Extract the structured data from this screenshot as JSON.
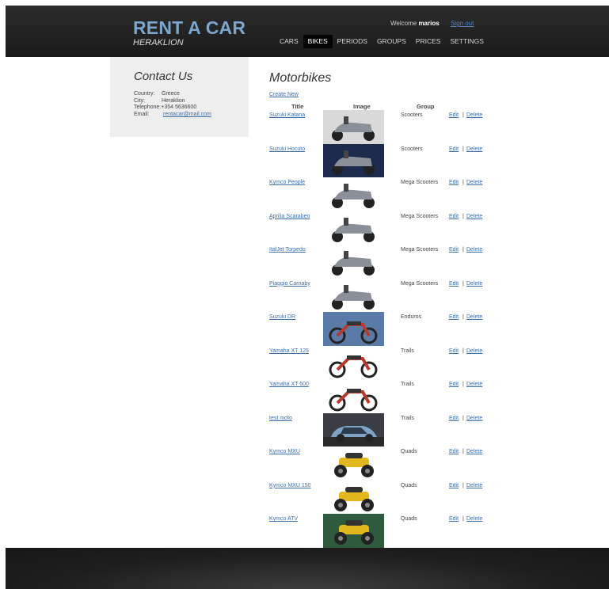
{
  "header": {
    "brand_title": "RENT A CAR",
    "brand_subtitle": "HERAKLION",
    "welcome_prefix": "Welcome",
    "username": "marios",
    "signout": "Sign out",
    "nav": [
      {
        "label": "CARS",
        "active": false
      },
      {
        "label": "BIKES",
        "active": true
      },
      {
        "label": "PERIODS",
        "active": false
      },
      {
        "label": "GROUPS",
        "active": false
      },
      {
        "label": "PRICES",
        "active": false
      },
      {
        "label": "SETTINGS",
        "active": false
      }
    ]
  },
  "sidebar": {
    "title": "Contact Us",
    "country_label": "Country:",
    "country": "Greece",
    "city_label": "City:",
    "city": "Heraklion",
    "telephone_label": "Telephone:",
    "telephone": "+354 5636600",
    "email_label": "Email:",
    "email": "rentacar@mail.com"
  },
  "main": {
    "title": "Motorbikes",
    "create_new": "Create New",
    "columns": {
      "title": "Title",
      "image": "Image",
      "group": "Group"
    },
    "edit_label": "Edit",
    "delete_label": "Delete",
    "separator": "|",
    "rows": [
      {
        "title": "Suzuki Katana",
        "group": "Scooters",
        "image_icon": "scooter-photo",
        "bg": "#d9d9d9"
      },
      {
        "title": "Suzuki Hocuto",
        "group": "Scooters",
        "image_icon": "scooter-photo",
        "bg": "#1c2a4e"
      },
      {
        "title": "Kymco People",
        "group": "Mega Scooters",
        "image_icon": "scooter-photo",
        "bg": "#ffffff"
      },
      {
        "title": "Aprilia Scarabeo",
        "group": "Mega Scooters",
        "image_icon": "scooter-photo",
        "bg": "#ffffff"
      },
      {
        "title": "ItalJet Torpedo",
        "group": "Mega Scooters",
        "image_icon": "scooter-photo",
        "bg": "#ffffff"
      },
      {
        "title": "Piaggio Carnaby",
        "group": "Mega Scooters",
        "image_icon": "scooter-photo",
        "bg": "#ffffff"
      },
      {
        "title": "Suzuki DR",
        "group": "Enduros",
        "image_icon": "motorcycle-photo",
        "bg": "#5a7aa8"
      },
      {
        "title": "Yamaha XT 125",
        "group": "Trails",
        "image_icon": "motorcycle-photo",
        "bg": "#ffffff"
      },
      {
        "title": "Yamaha XT 600",
        "group": "Trails",
        "image_icon": "motorcycle-photo",
        "bg": "#ffffff"
      },
      {
        "title": "test moto",
        "group": "Trails",
        "image_icon": "car-photo",
        "bg": "#3a3d44"
      },
      {
        "title": "Kymco MXU",
        "group": "Quads",
        "image_icon": "quad-photo",
        "bg": "#ffffff"
      },
      {
        "title": "Kymco MXU 150",
        "group": "Quads",
        "image_icon": "quad-photo",
        "bg": "#ffffff"
      },
      {
        "title": "Kymco ATV",
        "group": "Quads",
        "image_icon": "quad-photo",
        "bg": "#2f5a3e"
      }
    ]
  },
  "colors": {
    "header_bg": "#1f1f1f",
    "brand": "#7da6cf",
    "link": "#3b6ea8",
    "sidebar_bg": "#eeeeee"
  }
}
